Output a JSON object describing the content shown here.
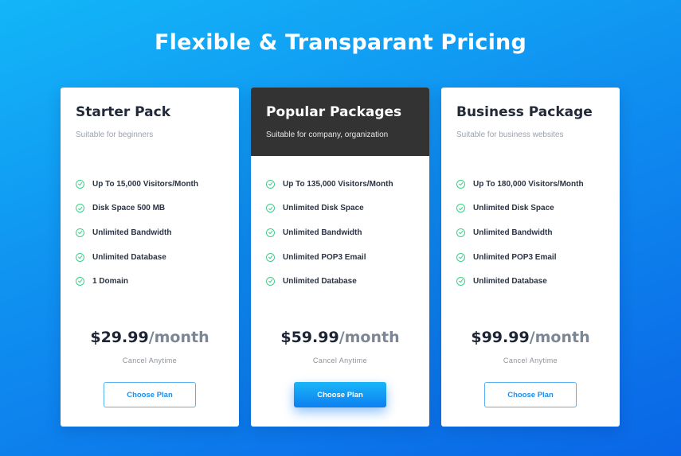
{
  "page": {
    "title": "Flexible & Transparant Pricing"
  },
  "colors": {
    "background_top": "#13b6f8",
    "background_bottom": "#0a66e6",
    "featured_header": "#333333",
    "check_green": "#3ecf86",
    "button_blue": "#1f8ee8"
  },
  "plans": [
    {
      "name": "Starter Pack",
      "subtitle": "Suitable for beginners",
      "features": [
        "Up To 15,000 Visitors/Month",
        "Disk Space 500 MB",
        "Unlimited Bandwidth",
        "Unlimited Database",
        "1 Domain"
      ],
      "price": "$29.99",
      "period": "/month",
      "note": "Cancel Anytime",
      "button": "Choose Plan"
    },
    {
      "name": "Popular Packages",
      "subtitle": "Suitable for company, organization",
      "features": [
        "Up To 135,000 Visitors/Month",
        "Unlimited Disk Space",
        "Unlimited Bandwidth",
        "Unlimited POP3 Email",
        "Unlimited Database"
      ],
      "price": "$59.99",
      "period": "/month",
      "note": "Cancel Anytime",
      "button": "Choose Plan"
    },
    {
      "name": "Business Package",
      "subtitle": "Suitable for business websites",
      "features": [
        "Up To 180,000 Visitors/Month",
        "Unlimited Disk Space",
        "Unlimited Bandwidth",
        "Unlimited POP3 Email",
        "Unlimited Database"
      ],
      "price": "$99.99",
      "period": "/month",
      "note": "Cancel Anytime",
      "button": "Choose Plan"
    }
  ],
  "icons": {
    "feature": "check-circle-icon"
  }
}
